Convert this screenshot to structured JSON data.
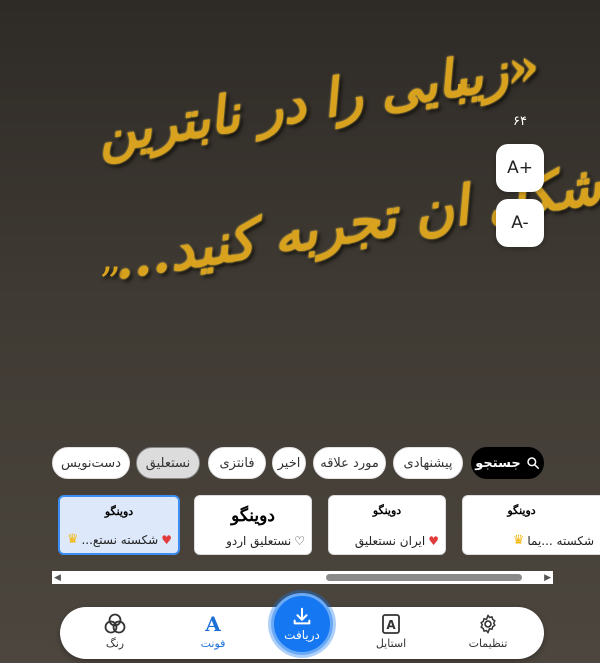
{
  "canvas": {
    "line1": "«زیبایی را در نابترین",
    "line2": "شکل ان تجربه کنید...",
    "quote_open": "”",
    "quote_close": "„"
  },
  "size_controls": {
    "value": "۶۴",
    "increase_label": "A+",
    "decrease_label": "A-"
  },
  "categories": [
    {
      "label": "جستجو",
      "icon": "search-icon"
    },
    {
      "label": "پیشنهادی"
    },
    {
      "label": "مورد علاقه"
    },
    {
      "label": "اخیر"
    },
    {
      "label": "فانتزی"
    },
    {
      "label": "نستعلیق",
      "selected": true
    },
    {
      "label": "دست‌نویس"
    }
  ],
  "font_cards": [
    {
      "sample": "دوینگو",
      "name": "شکسته نستع...",
      "favorite": true,
      "premium": true,
      "selected": true
    },
    {
      "sample": "دوینگو",
      "name": "نستعلیق اردو",
      "favorite": false,
      "premium": false
    },
    {
      "sample": "دوینگو",
      "name": "ایران نستعلیق",
      "favorite": true,
      "premium": false
    },
    {
      "sample": "دوینگو",
      "name": "شکسته ...یما",
      "favorite": false,
      "premium": true
    }
  ],
  "bottom_nav": {
    "settings": "تنظیمات",
    "style": "استایل",
    "download": "دریافت",
    "font": "فونت",
    "color": "رنگ"
  },
  "colors": {
    "accent": "#1577f2",
    "gold": "#d9a21e",
    "favorite": "#e23b3b",
    "premium": "#f4b400"
  }
}
